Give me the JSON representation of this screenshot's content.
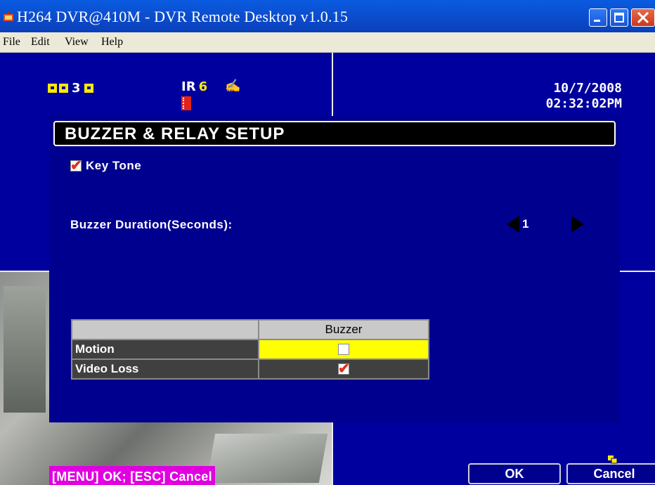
{
  "window": {
    "title": "H264 DVR@410M - DVR Remote Desktop v1.0.15"
  },
  "menu": {
    "items": [
      "File",
      "Edit",
      "View",
      "Help"
    ]
  },
  "osd": {
    "channel_label": "3",
    "ir_label": "IR",
    "ir_channel": "6",
    "date": "10/7/2008",
    "time": "02:32:02PM"
  },
  "dialog": {
    "title": "BUZZER & RELAY SETUP",
    "key_tone_label": "Key Tone",
    "key_tone_checked": true,
    "buzzer_duration_label": "Buzzer Duration(Seconds):",
    "buzzer_duration_value": "1",
    "table": {
      "column_header": "Buzzer",
      "rows": [
        {
          "label": "Motion",
          "checked": false,
          "selected": true
        },
        {
          "label": "Video Loss",
          "checked": true,
          "selected": false
        }
      ]
    },
    "hint": "[MENU] OK; [ESC] Cancel",
    "ok_label": "OK",
    "cancel_label": "Cancel"
  },
  "colors": {
    "osd_background": "#00009e",
    "highlight": "#ffff00",
    "hint_bg": "#e000e0"
  }
}
